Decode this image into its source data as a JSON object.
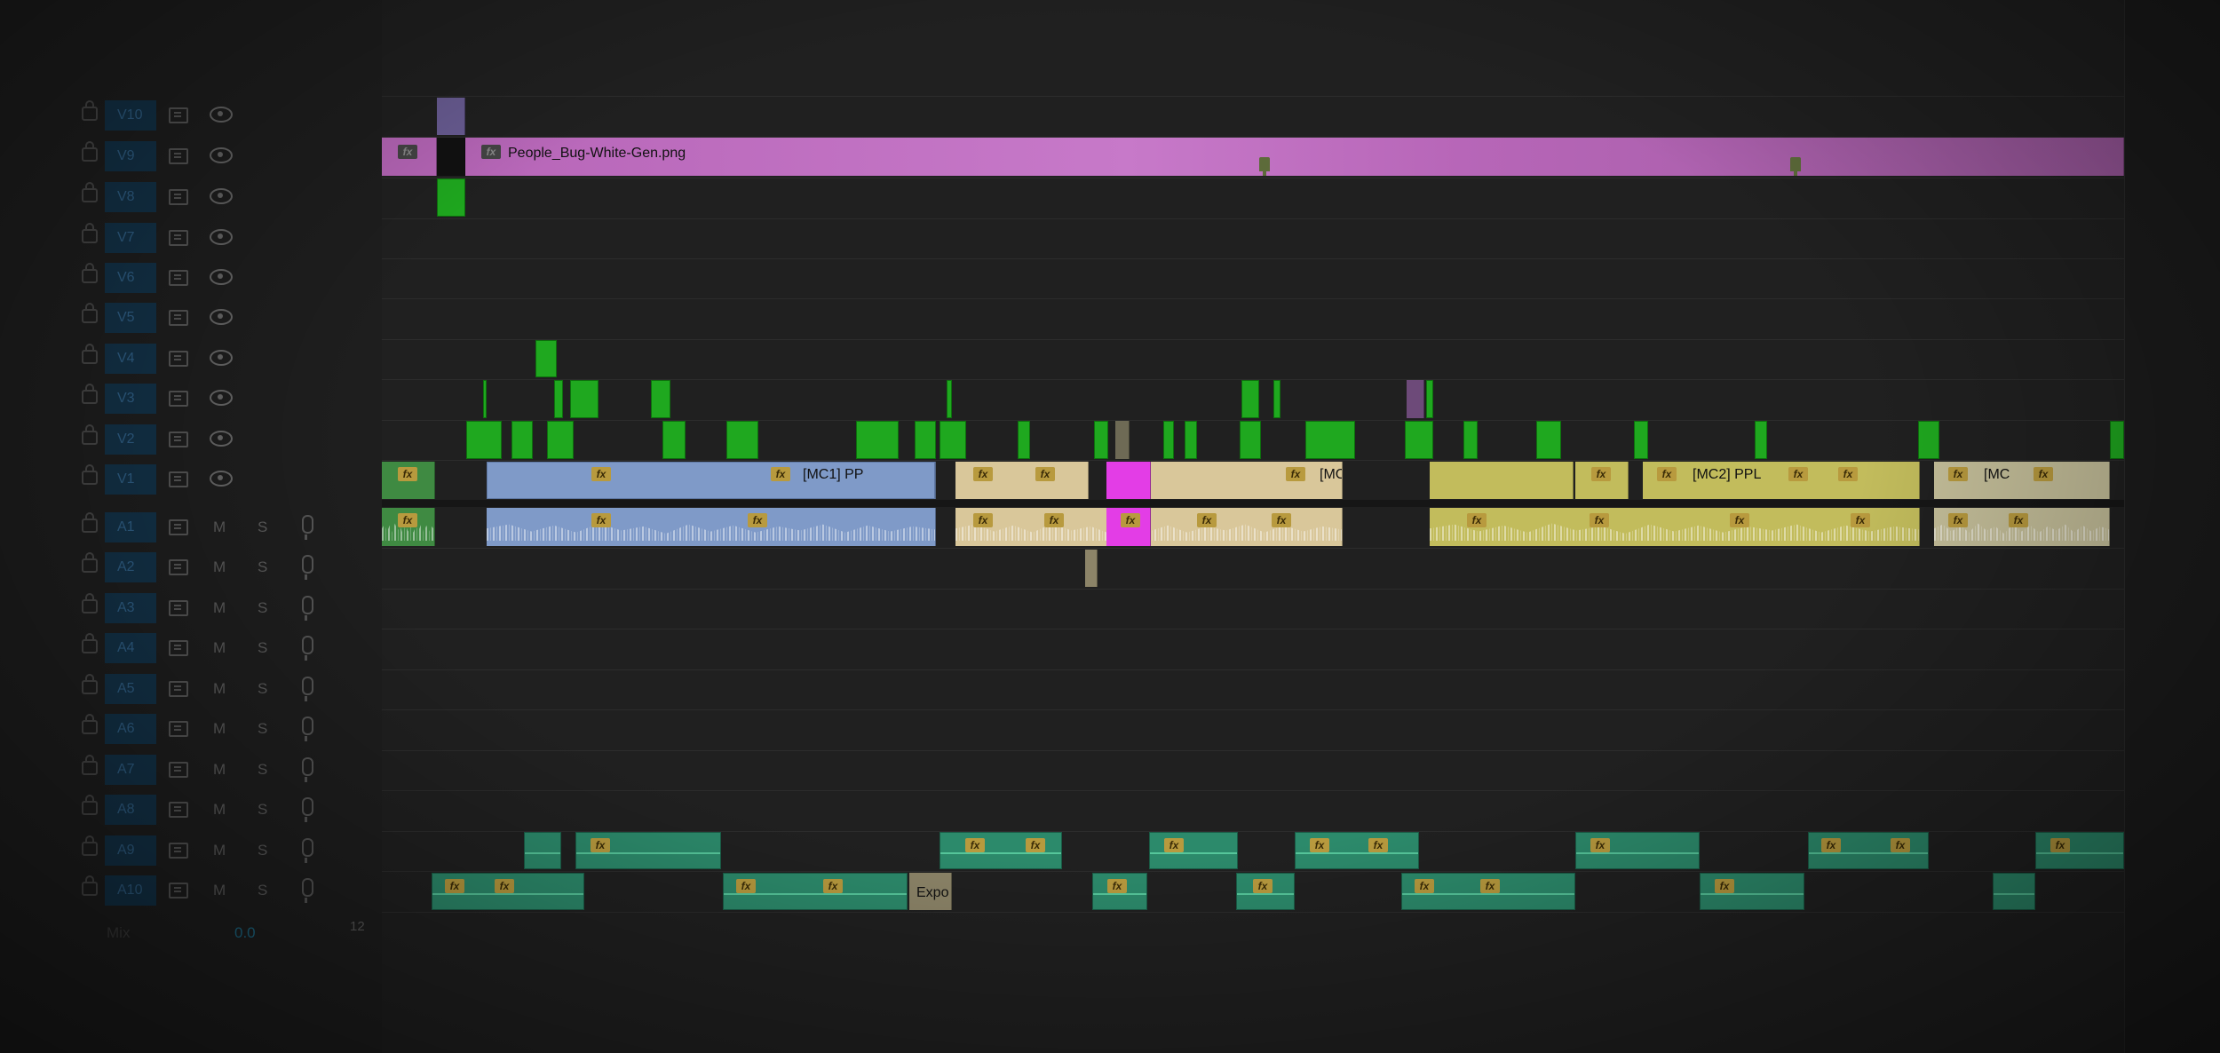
{
  "video_tracks": [
    "V10",
    "V9",
    "V8",
    "V7",
    "V6",
    "V5",
    "V4",
    "V3",
    "V2",
    "V1"
  ],
  "audio_tracks": [
    "A1",
    "A2",
    "A3",
    "A4",
    "A5",
    "A6",
    "A7",
    "A8",
    "A9",
    "A10"
  ],
  "audio_controls": {
    "mute": "M",
    "solo": "S"
  },
  "mix": {
    "label": "Mix",
    "value": "0.0",
    "level_scale": "12"
  },
  "clips": {
    "v9_graphic": "People_Bug-White-Gen.png",
    "mc1": "[MC1] PP",
    "mc_b": "[MC",
    "mc2": "[MC2] PPL",
    "mc_c": "[MC",
    "expo": "Expo"
  },
  "effect_badge": "fx",
  "colors": {
    "graphic_clip": "#b766b8",
    "mc1_clip": "#7f9ac8",
    "mc_b_clip": "#d9c79a",
    "mc2_clip": "#c2bc5c",
    "mc_c_clip": "#c5bf9a",
    "broll_clip": "#1fa81f",
    "adjustment_clip": "#e33de6",
    "music_clip": "#2c8a6b",
    "target_blue": "#133248"
  }
}
